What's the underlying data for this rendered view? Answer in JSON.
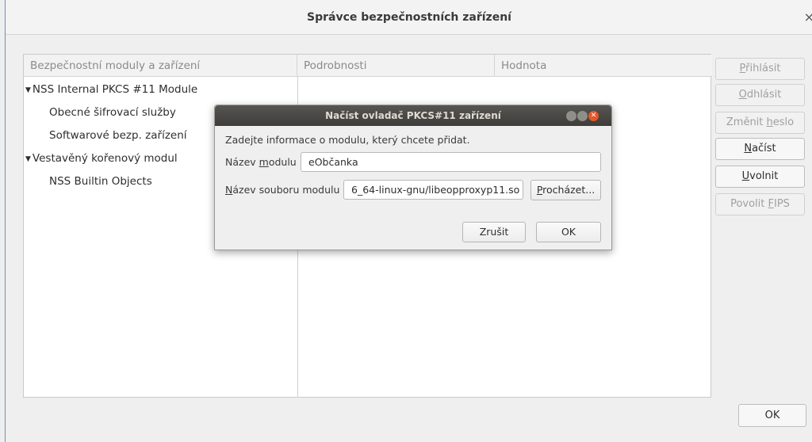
{
  "window": {
    "title": "Správce bezpečnostních zařízení",
    "close_glyph": "×"
  },
  "table": {
    "headers": [
      "Bezpečnostní moduly a zařízení",
      "Podrobnosti",
      "Hodnota"
    ],
    "tree": [
      {
        "label": "NSS Internal PKCS #11 Module",
        "expanded": true,
        "level": 0
      },
      {
        "label": "Obecné šifrovací služby",
        "level": 1
      },
      {
        "label": "Softwarové bezp. zařízení",
        "level": 1
      },
      {
        "label": "Vestavěný kořenový modul",
        "expanded": true,
        "level": 0
      },
      {
        "label": "NSS Builtin Objects",
        "level": 1
      }
    ]
  },
  "side_buttons": [
    {
      "pre": "",
      "mnemonic": "P",
      "post": "řihlásit",
      "enabled": false
    },
    {
      "pre": "",
      "mnemonic": "O",
      "post": "dhlásit",
      "enabled": false
    },
    {
      "pre": "Změnit ",
      "mnemonic": "h",
      "post": "eslo",
      "enabled": false
    },
    {
      "pre": "",
      "mnemonic": "N",
      "post": "ačíst",
      "enabled": true
    },
    {
      "pre": "",
      "mnemonic": "U",
      "post": "volnit",
      "enabled": true
    },
    {
      "pre": "Povolit ",
      "mnemonic": "F",
      "post": "IPS",
      "enabled": false
    }
  ],
  "ok_label": "OK",
  "dialog": {
    "title": "Načíst ovladač PKCS#11 zařízení",
    "prompt": "Zadejte informace o modulu, který chcete přidat.",
    "module_name_label_pre": "Název ",
    "module_name_label_mn": "m",
    "module_name_label_post": "odulu",
    "module_name_value": "eObčanka",
    "file_label_pre": "",
    "file_label_mn": "N",
    "file_label_post": "ázev souboru modulu",
    "file_value": "6_64-linux-gnu/libeopproxyp11.so",
    "browse_pre": "",
    "browse_mn": "P",
    "browse_post": "rocházet...",
    "cancel_label": "Zrušit",
    "ok_label": "OK",
    "titlebar_colors": {
      "close": "#e2582c",
      "other": "#8f8f8a"
    }
  }
}
